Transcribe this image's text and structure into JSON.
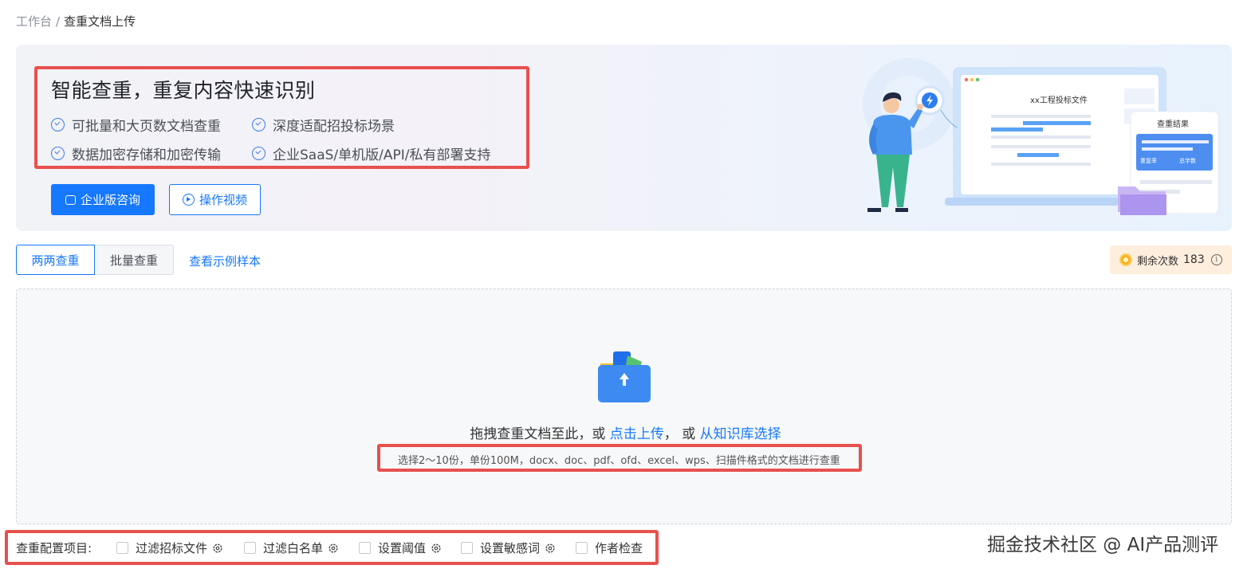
{
  "breadcrumb": {
    "root": "工作台",
    "separator": "/",
    "current": "查重文档上传"
  },
  "banner": {
    "title": "智能查重，重复内容快速识别",
    "features": [
      "可批量和大页数文档查重",
      "深度适配招投标场景",
      "数据加密存储和加密传输",
      "企业SaaS/单机版/API/私有部署支持"
    ],
    "primary_button": "企业版咨询",
    "video_button": "操作视频",
    "illustration": {
      "doc_title": "xx工程投标文件",
      "result_title": "查重结果",
      "result_label_1": "重复率",
      "result_label_2": "总字数"
    }
  },
  "tabs": [
    {
      "label": "两两查重",
      "active": true
    },
    {
      "label": "批量查重",
      "active": false
    }
  ],
  "sample_link": "查看示例样本",
  "remaining": {
    "label": "剩余次数",
    "count": "183"
  },
  "upload": {
    "prefix": "拖拽查重文档至此，或 ",
    "click_link": "点击上传",
    "middle": "， 或 ",
    "kb_link": "从知识库选择",
    "hint": "选择2～10份，单份100M，docx、doc、pdf、ofd、excel、wps、扫描件格式的文档进行查重"
  },
  "config": {
    "label": "查重配置项目:",
    "items": [
      {
        "label": "过滤招标文件",
        "has_gear": true
      },
      {
        "label": "过滤白名单",
        "has_gear": true
      },
      {
        "label": "设置阈值",
        "has_gear": true
      },
      {
        "label": "设置敏感词",
        "has_gear": true
      },
      {
        "label": "作者检查",
        "has_gear": false
      }
    ]
  },
  "watermark": "掘金技术社区 @ AI产品测评",
  "colors": {
    "accent": "#1677ff",
    "highlight": "#e8504e",
    "remaining_bg": "#fdeedd"
  }
}
